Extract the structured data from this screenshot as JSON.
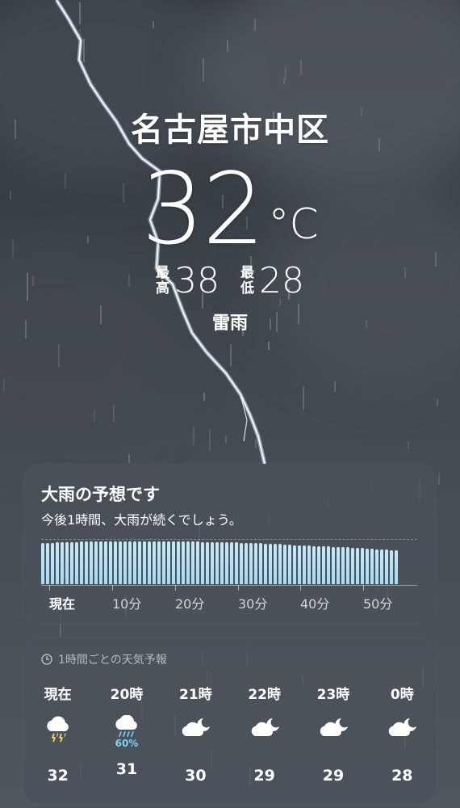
{
  "location": "名古屋市中区",
  "current": {
    "temp": "32",
    "unit": "°C",
    "condition": "雷雨"
  },
  "high": {
    "label": [
      "最",
      "高"
    ],
    "value": "38"
  },
  "low": {
    "label": [
      "最",
      "低"
    ],
    "value": "28"
  },
  "precip_card": {
    "title": "大雨の予想です",
    "subtitle": "今後1時間、大雨が続くでしょう。",
    "labels": [
      "現在",
      "10分",
      "20分",
      "30分",
      "40分",
      "50分"
    ],
    "intensity": [
      0.92,
      0.93,
      0.93,
      0.94,
      0.94,
      0.95,
      0.95,
      0.95,
      0.96,
      0.96,
      0.96,
      0.96,
      0.96,
      0.96,
      0.96,
      0.96,
      0.96,
      0.96,
      0.96,
      0.96,
      0.96,
      0.96,
      0.96,
      0.96,
      0.96,
      0.96,
      0.96,
      0.96,
      0.96,
      0.96,
      0.96,
      0.96,
      0.96,
      0.95,
      0.95,
      0.95,
      0.95,
      0.95,
      0.94,
      0.94,
      0.94,
      0.93,
      0.93,
      0.93,
      0.92,
      0.92,
      0.91,
      0.91,
      0.9,
      0.9,
      0.89,
      0.89,
      0.88,
      0.88,
      0.87,
      0.87,
      0.86,
      0.86,
      0.85,
      0.85,
      0.84,
      0.84,
      0.83,
      0.83,
      0.82,
      0.82,
      0.81,
      0.8,
      0.8,
      0.79,
      0.78,
      0.78,
      0.77,
      0.77
    ]
  },
  "hourly_card": {
    "header": "1時間ごとの天気予報",
    "hours": [
      {
        "time": "現在",
        "icon": "thunderstorm-icon",
        "pct": "",
        "temp": "32"
      },
      {
        "time": "20時",
        "icon": "heavy-rain-icon",
        "pct": "60%",
        "temp": "31"
      },
      {
        "time": "21時",
        "icon": "cloudy-night-icon",
        "pct": "",
        "temp": "30"
      },
      {
        "time": "22時",
        "icon": "cloudy-night-icon",
        "pct": "",
        "temp": "29"
      },
      {
        "time": "23時",
        "icon": "cloudy-night-icon",
        "pct": "",
        "temp": "29"
      },
      {
        "time": "0時",
        "icon": "cloudy-night-icon",
        "pct": "",
        "temp": "28"
      }
    ]
  },
  "colors": {
    "bar": "#a6dcf2",
    "precip_pct": "#7fd2f5"
  }
}
